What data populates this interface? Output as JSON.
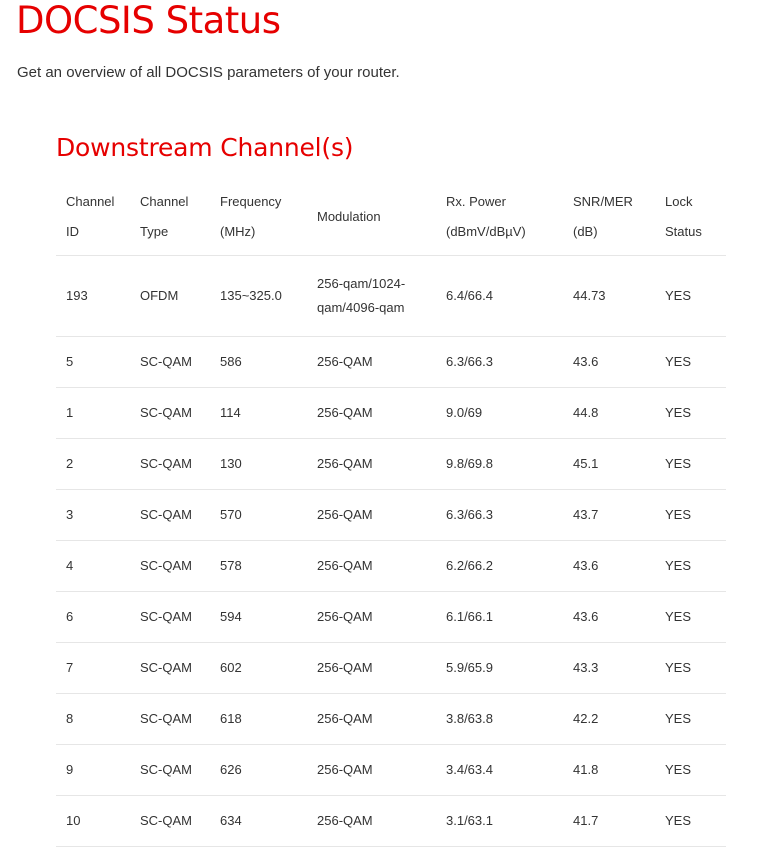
{
  "page": {
    "title": "DOCSIS Status",
    "subtitle": "Get an overview of all DOCSIS parameters of your router."
  },
  "downstream": {
    "section_title": "Downstream Channel(s)",
    "columns": [
      [
        "Channel",
        "ID"
      ],
      [
        "Channel",
        "Type"
      ],
      [
        "Frequency",
        "(MHz)"
      ],
      [
        "Modulation"
      ],
      [
        "Rx. Power",
        "(dBmV/dBµV)"
      ],
      [
        "SNR/MER",
        "(dB)"
      ],
      [
        "Lock",
        "Status"
      ]
    ],
    "rows": [
      [
        "193",
        "OFDM",
        "135~325.0",
        "256-qam/1024-qam/4096-qam",
        "6.4/66.4",
        "44.73",
        "YES"
      ],
      [
        "5",
        "SC-QAM",
        "586",
        "256-QAM",
        "6.3/66.3",
        "43.6",
        "YES"
      ],
      [
        "1",
        "SC-QAM",
        "114",
        "256-QAM",
        "9.0/69",
        "44.8",
        "YES"
      ],
      [
        "2",
        "SC-QAM",
        "130",
        "256-QAM",
        "9.8/69.8",
        "45.1",
        "YES"
      ],
      [
        "3",
        "SC-QAM",
        "570",
        "256-QAM",
        "6.3/66.3",
        "43.7",
        "YES"
      ],
      [
        "4",
        "SC-QAM",
        "578",
        "256-QAM",
        "6.2/66.2",
        "43.6",
        "YES"
      ],
      [
        "6",
        "SC-QAM",
        "594",
        "256-QAM",
        "6.1/66.1",
        "43.6",
        "YES"
      ],
      [
        "7",
        "SC-QAM",
        "602",
        "256-QAM",
        "5.9/65.9",
        "43.3",
        "YES"
      ],
      [
        "8",
        "SC-QAM",
        "618",
        "256-QAM",
        "3.8/63.8",
        "42.2",
        "YES"
      ],
      [
        "9",
        "SC-QAM",
        "626",
        "256-QAM",
        "3.4/63.4",
        "41.8",
        "YES"
      ],
      [
        "10",
        "SC-QAM",
        "634",
        "256-QAM",
        "3.1/63.1",
        "41.7",
        "YES"
      ]
    ]
  },
  "colors": {
    "accent_red": "#e60000",
    "text": "#333333",
    "row_divider": "#e6e6e6"
  }
}
